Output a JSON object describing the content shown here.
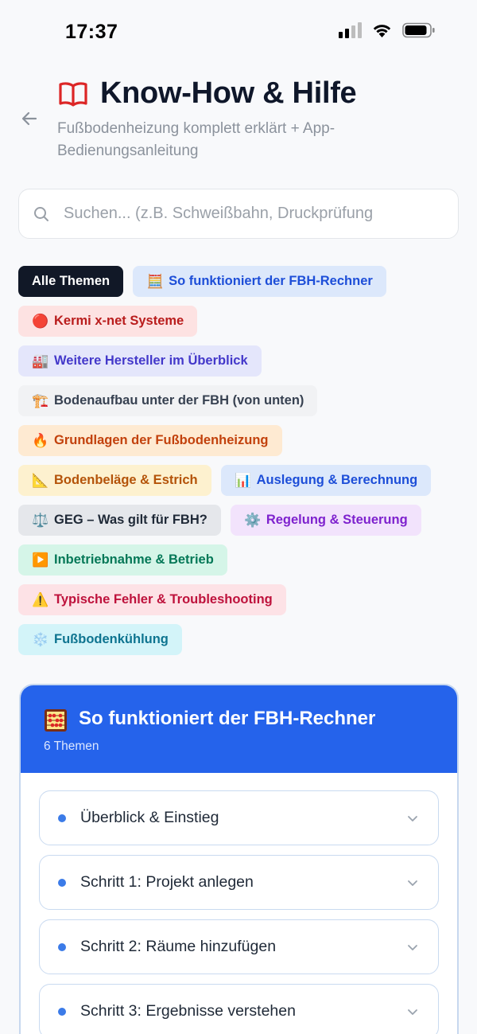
{
  "status_bar": {
    "time": "17:37"
  },
  "header": {
    "title": "Know-How & Hilfe",
    "subtitle": "Fußbodenheizung komplett erklärt + App-Bedienungsanleitung"
  },
  "search": {
    "placeholder": "Suchen... (z.B. Schweißbahn, Druckprüfung",
    "value": ""
  },
  "chips": [
    {
      "label": "Alle Themen",
      "emoji": "",
      "bg": "#111827",
      "fg": "#ffffff",
      "active": true
    },
    {
      "label": "So funktioniert der FBH-Rechner",
      "emoji": "🧮",
      "bg": "#dce8fb",
      "fg": "#1d4ed8"
    },
    {
      "label": "Kermi x-net Systeme",
      "emoji": "🔴",
      "bg": "#fde2e2",
      "fg": "#b91c1c"
    },
    {
      "label": "Weitere Hersteller im Überblick",
      "emoji": "🏭",
      "bg": "#e4e6fb",
      "fg": "#4338ca"
    },
    {
      "label": "Bodenaufbau unter der FBH (von unten)",
      "emoji": "🏗️",
      "bg": "#f1f2f4",
      "fg": "#374151"
    },
    {
      "label": "Grundlagen der Fußbodenheizung",
      "emoji": "🔥",
      "bg": "#feead2",
      "fg": "#c2410c"
    },
    {
      "label": "Bodenbeläge & Estrich",
      "emoji": "📐",
      "bg": "#fdf1cf",
      "fg": "#b45309"
    },
    {
      "label": "Auslegung & Berechnung",
      "emoji": "📊",
      "bg": "#dce8fb",
      "fg": "#1d4ed8"
    },
    {
      "label": "GEG – Was gilt für FBH?",
      "emoji": "⚖️",
      "bg": "#e5e7eb",
      "fg": "#1f2937"
    },
    {
      "label": "Regelung & Steuerung",
      "emoji": "⚙️",
      "bg": "#f2e3fc",
      "fg": "#7e22ce"
    },
    {
      "label": "Inbetriebnahme & Betrieb",
      "emoji": "▶️",
      "bg": "#d5f5e8",
      "fg": "#047857"
    },
    {
      "label": "Typische Fehler & Troubleshooting",
      "emoji": "⚠️",
      "bg": "#fde2e6",
      "fg": "#be123c"
    },
    {
      "label": "Fußbodenkühlung",
      "emoji": "❄️",
      "bg": "#d3f4f9",
      "fg": "#0e7490"
    }
  ],
  "section": {
    "title": "So funktioniert der FBH-Rechner",
    "count": "6 Themen",
    "accent": "#2563eb",
    "items": [
      {
        "label": "Überblick & Einstieg"
      },
      {
        "label": "Schritt 1: Projekt anlegen"
      },
      {
        "label": "Schritt 2: Räume hinzufügen"
      },
      {
        "label": "Schritt 3: Ergebnisse verstehen"
      }
    ]
  }
}
